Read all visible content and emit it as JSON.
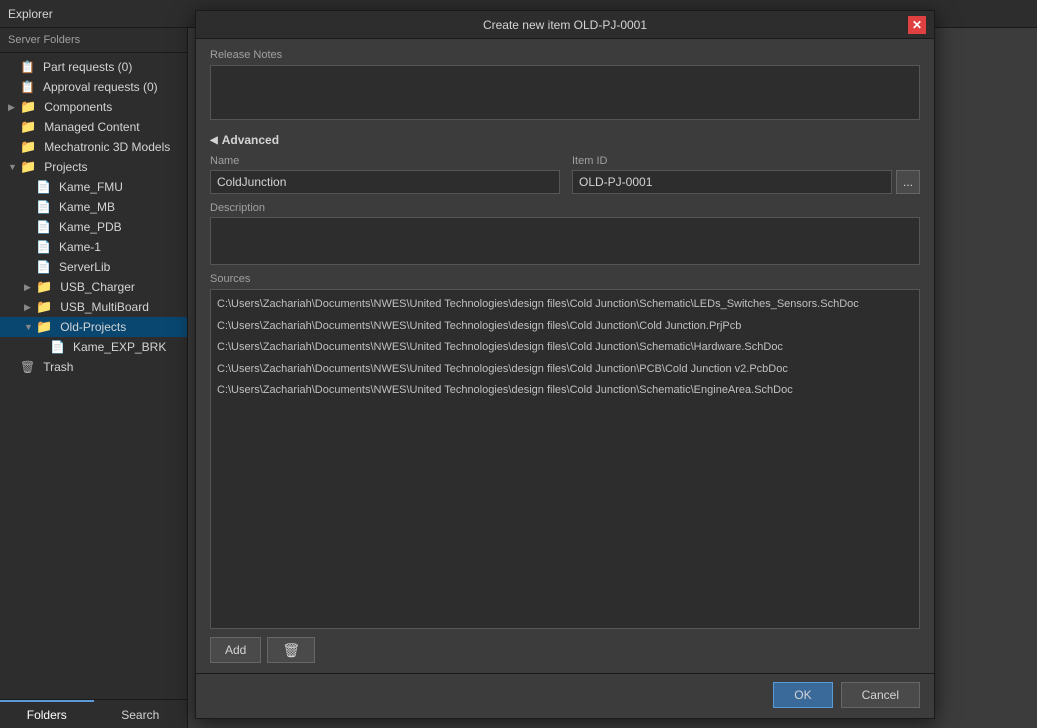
{
  "titleBar": {
    "text": "Explorer"
  },
  "sidebar": {
    "header": "Server Folders",
    "items": [
      {
        "id": "part-requests",
        "label": "Part requests (0)",
        "indent": 1,
        "iconType": "blue",
        "hasArrow": false
      },
      {
        "id": "approval-requests",
        "label": "Approval requests (0)",
        "indent": 1,
        "iconType": "blue",
        "hasArrow": false
      },
      {
        "id": "components",
        "label": "Components",
        "indent": 1,
        "iconType": "folder",
        "hasArrow": true,
        "expanded": false
      },
      {
        "id": "managed-content",
        "label": "Managed Content",
        "indent": 1,
        "iconType": "folder",
        "hasArrow": false
      },
      {
        "id": "mechatronic",
        "label": "Mechatronic 3D Models",
        "indent": 1,
        "iconType": "folder",
        "hasArrow": false
      },
      {
        "id": "projects",
        "label": "Projects",
        "indent": 1,
        "iconType": "folder",
        "hasArrow": true,
        "expanded": true
      },
      {
        "id": "kame-fmu",
        "label": "Kame_FMU",
        "indent": 2,
        "iconType": "file",
        "hasArrow": false
      },
      {
        "id": "kame-mb",
        "label": "Kame_MB",
        "indent": 2,
        "iconType": "file",
        "hasArrow": false
      },
      {
        "id": "kame-pdb",
        "label": "Kame_PDB",
        "indent": 2,
        "iconType": "file",
        "hasArrow": false
      },
      {
        "id": "kame-1",
        "label": "Kame-1",
        "indent": 2,
        "iconType": "file",
        "hasArrow": false
      },
      {
        "id": "serverlib",
        "label": "ServerLib",
        "indent": 2,
        "iconType": "file",
        "hasArrow": false
      },
      {
        "id": "usb-charger",
        "label": "USB_Charger",
        "indent": 2,
        "iconType": "folder",
        "hasArrow": true,
        "expanded": false
      },
      {
        "id": "usb-multiboard",
        "label": "USB_MultiBoard",
        "indent": 2,
        "iconType": "folder",
        "hasArrow": true,
        "expanded": false
      },
      {
        "id": "old-projects",
        "label": "Old-Projects",
        "indent": 2,
        "iconType": "folder",
        "hasArrow": true,
        "expanded": true,
        "selected": true
      },
      {
        "id": "kame-exp-brk",
        "label": "Kame_EXP_BRK",
        "indent": 3,
        "iconType": "file",
        "hasArrow": false
      },
      {
        "id": "trash",
        "label": "Trash",
        "indent": 1,
        "iconType": "trash",
        "hasArrow": false
      }
    ],
    "tabs": [
      {
        "id": "folders",
        "label": "Folders",
        "active": true
      },
      {
        "id": "search",
        "label": "Search",
        "active": false
      }
    ]
  },
  "modal": {
    "title": "Create new item OLD-PJ-0001",
    "releaseNotesLabel": "Release Notes",
    "releaseNotesValue": "",
    "advancedLabel": "Advanced",
    "nameLabel": "Name",
    "nameValue": "ColdJunction",
    "itemIdLabel": "Item ID",
    "itemIdValue": "OLD-PJ-0001",
    "descriptionLabel": "Description",
    "descriptionValue": "",
    "sourcesLabel": "Sources",
    "sourceItems": [
      "C:\\Users\\Zachariah\\Documents\\NWES\\United Technologies\\design files\\Cold Junction\\Schematic\\LEDs_Switches_Sensors.SchDoc",
      "C:\\Users\\Zachariah\\Documents\\NWES\\United Technologies\\design files\\Cold Junction\\Cold Junction.PrjPcb",
      "C:\\Users\\Zachariah\\Documents\\NWES\\United Technologies\\design files\\Cold Junction\\Schematic\\Hardware.SchDoc",
      "C:\\Users\\Zachariah\\Documents\\NWES\\United Technologies\\design files\\Cold Junction\\PCB\\Cold Junction v2.PcbDoc",
      "C:\\Users\\Zachariah\\Documents\\NWES\\United Technologies\\design files\\Cold Junction\\Schematic\\EngineArea.SchDoc"
    ],
    "addButtonLabel": "Add",
    "deleteButtonLabel": "",
    "okButtonLabel": "OK",
    "cancelButtonLabel": "Cancel",
    "dotsLabel": "..."
  }
}
